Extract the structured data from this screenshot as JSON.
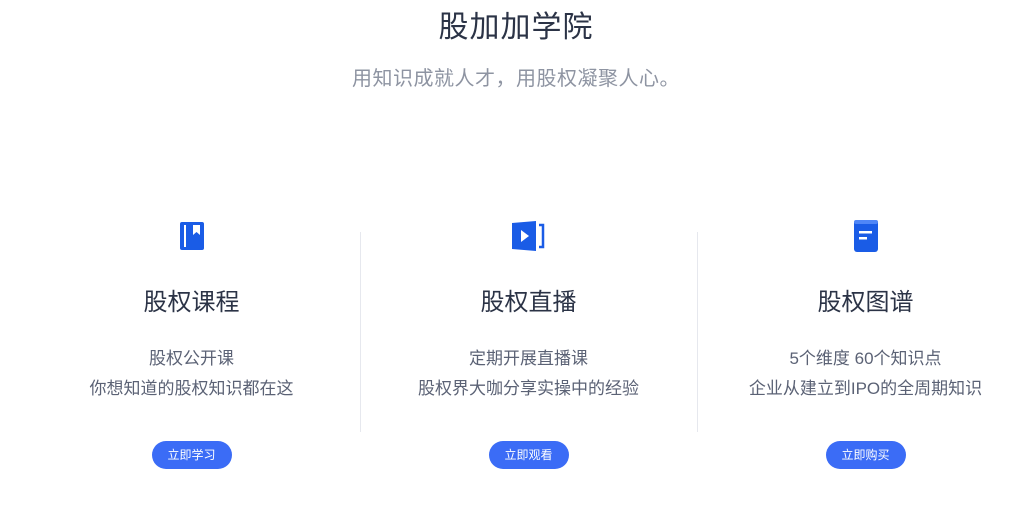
{
  "header": {
    "title": "股加加学院",
    "subtitle": "用知识成就人才，用股权凝聚人心。"
  },
  "theme": {
    "accent": "#3b6cf6",
    "icon_color": "#1a5ce6"
  },
  "cards": [
    {
      "icon": "book-icon",
      "title": "股权课程",
      "line1": "股权公开课",
      "line2": "你想知道的股权知识都在这",
      "button": "立即学习"
    },
    {
      "icon": "video-play-icon",
      "title": "股权直播",
      "line1": "定期开展直播课",
      "line2": "股权界大咖分享实操中的经验",
      "button": "立即观看"
    },
    {
      "icon": "document-icon",
      "title": "股权图谱",
      "line1": "5个维度 60个知识点",
      "line2": "企业从建立到IPO的全周期知识",
      "button": "立即购买"
    }
  ]
}
